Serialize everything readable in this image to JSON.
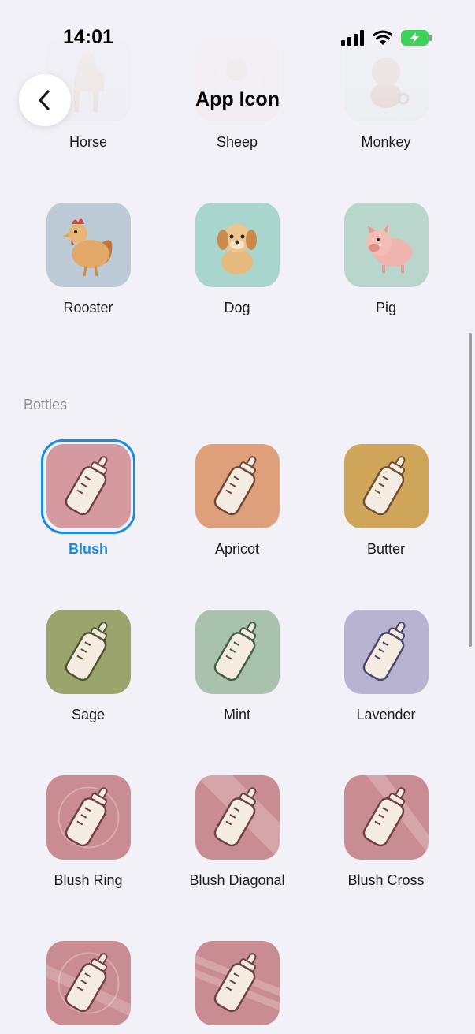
{
  "status_bar": {
    "time": "14:01"
  },
  "nav": {
    "title": "App Icon"
  },
  "animals_top": [
    {
      "label": "Horse",
      "icon": "horse-icon",
      "bg": "#dcdcee"
    },
    {
      "label": "Sheep",
      "icon": "sheep-icon",
      "bg": "#f0d8dc"
    },
    {
      "label": "Monkey",
      "icon": "monkey-icon",
      "bg": "#cfe4d8"
    }
  ],
  "animals": [
    {
      "label": "Rooster",
      "icon": "rooster-icon",
      "bg": "#bccbd6"
    },
    {
      "label": "Dog",
      "icon": "dog-icon",
      "bg": "#a8d6cc"
    },
    {
      "label": "Pig",
      "icon": "pig-icon",
      "bg": "#b9d6cd"
    }
  ],
  "bottles_section": {
    "title": "Bottles"
  },
  "bottles": [
    {
      "label": "Blush",
      "bg": "#d49a9f",
      "selected": true
    },
    {
      "label": "Apricot",
      "bg": "#dea07a"
    },
    {
      "label": "Butter",
      "bg": "#cfa55a"
    },
    {
      "label": "Sage",
      "bg": "#9aa46c"
    },
    {
      "label": "Mint",
      "bg": "#a9c2ad"
    },
    {
      "label": "Lavender",
      "bg": "#b7b3d0"
    },
    {
      "label": "Blush Ring",
      "bg": "#c98c92",
      "pattern": "ring"
    },
    {
      "label": "Blush Diagonal",
      "bg": "#c98c92",
      "pattern": "diagonal"
    },
    {
      "label": "Blush Cross",
      "bg": "#c98c92",
      "pattern": "cross"
    },
    {
      "label": "",
      "bg": "#c98c92",
      "pattern": "ring-cross"
    },
    {
      "label": "",
      "bg": "#c98c92",
      "pattern": "stripes"
    }
  ],
  "colors": {
    "accent": "#1a8be0",
    "background": "#f2f1f7"
  }
}
